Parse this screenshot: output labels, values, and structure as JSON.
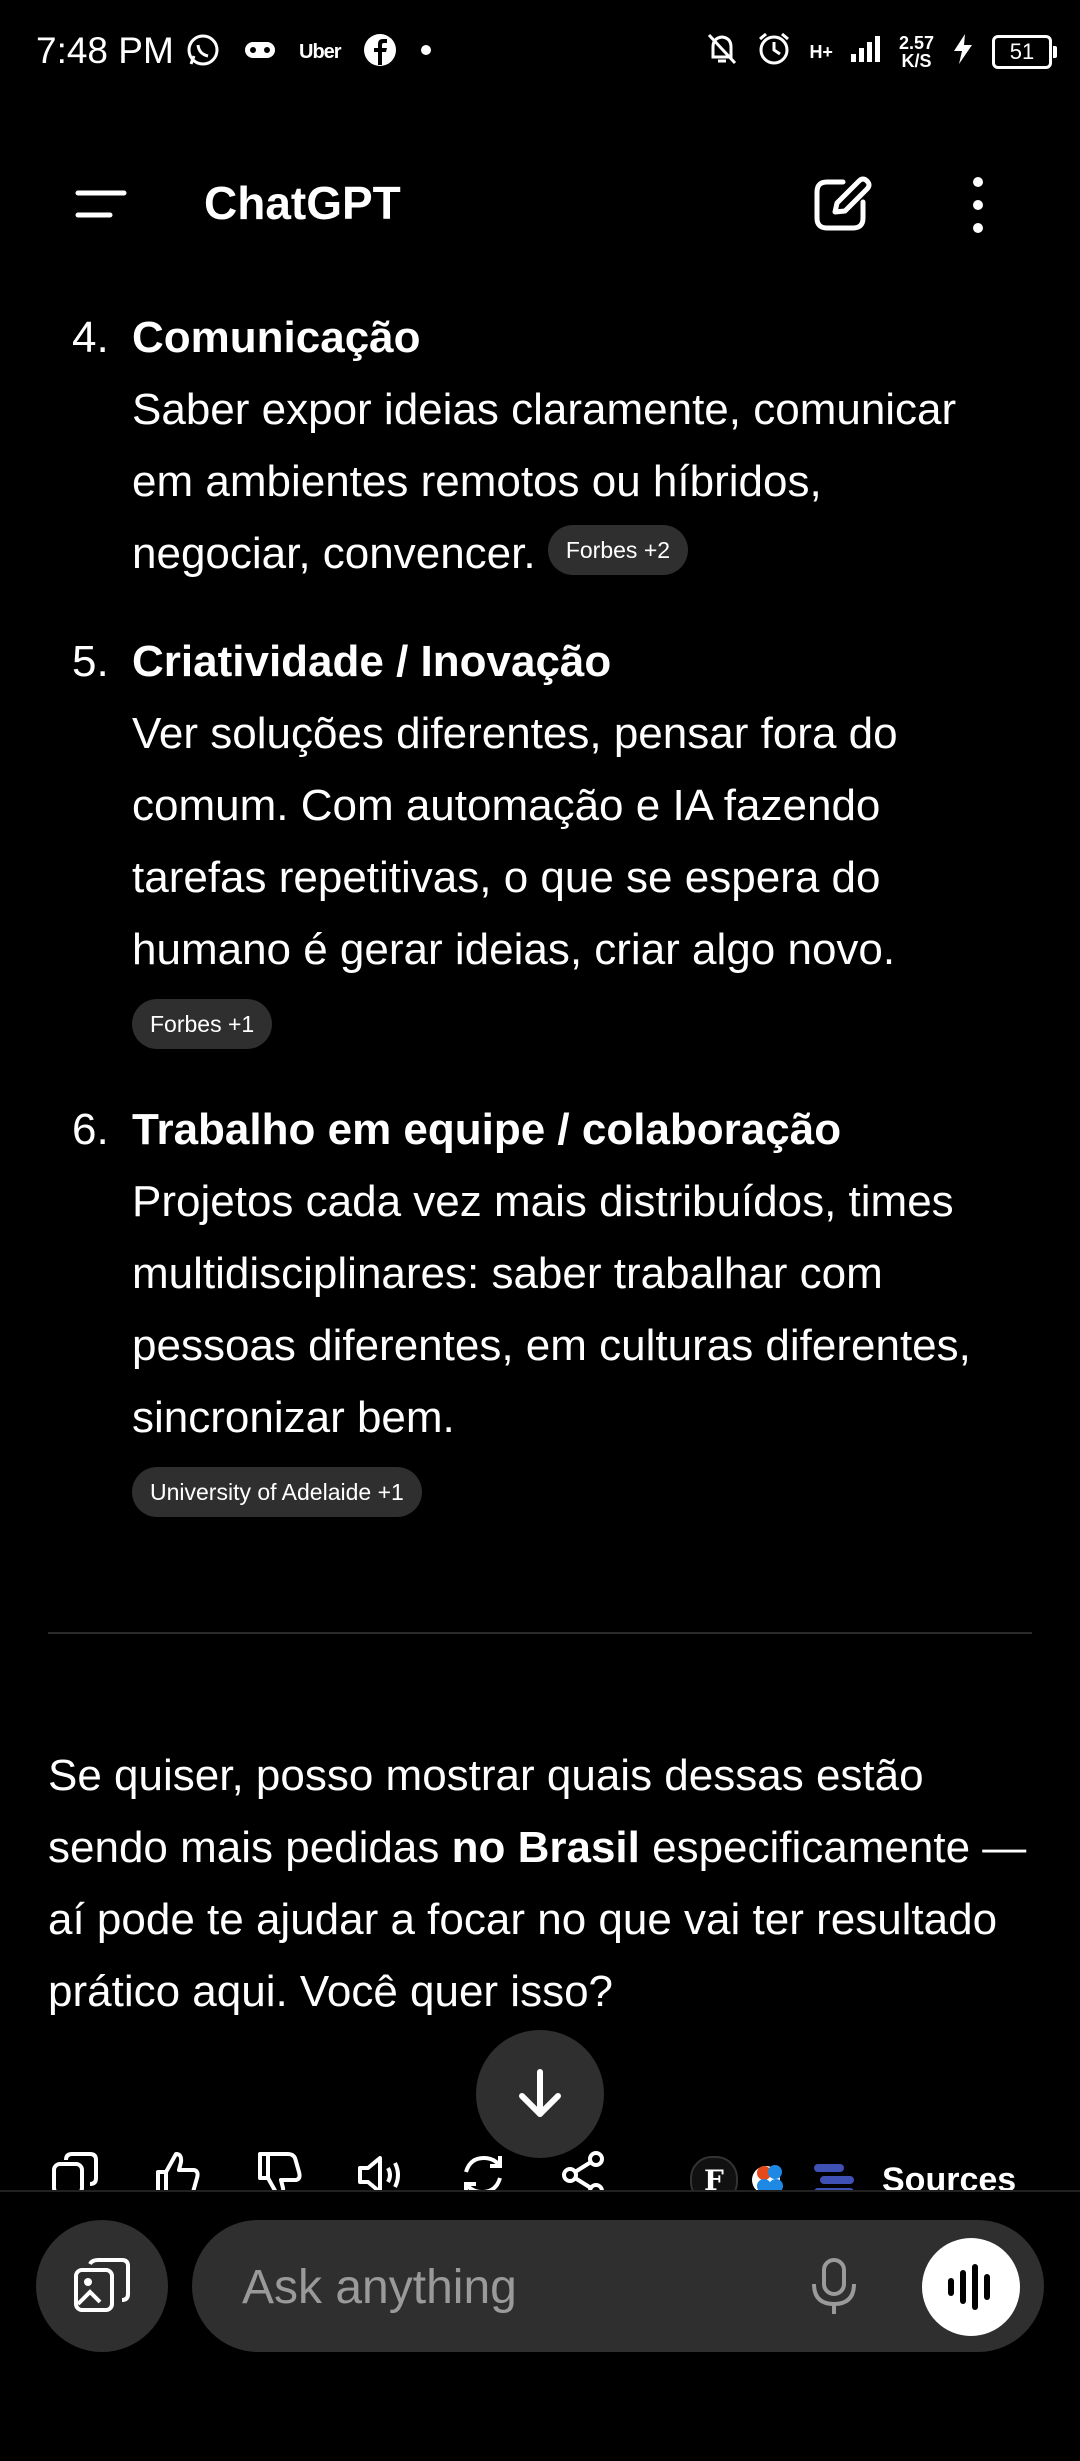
{
  "status_bar": {
    "time": "7:48 PM",
    "uber_label": "Uber",
    "net_type": "H+",
    "net_speed_value": "2.57",
    "net_speed_unit": "K/S",
    "battery": "51"
  },
  "app_bar": {
    "title": "ChatGPT"
  },
  "items": [
    {
      "number": "4.",
      "title": "Comunicação",
      "text": "Saber expor ideias claramente, comunicar em ambientes remotos ou híbridos, negociar, convencer.",
      "source_chip": "Forbes +2"
    },
    {
      "number": "5.",
      "title": "Criatividade / Inovação",
      "text": "Ver soluções diferentes, pensar fora do comum. Com automação e IA fazendo tarefas repetitivas, o que se espera do humano é gerar ideias, criar algo novo.",
      "source_chip": "Forbes +1"
    },
    {
      "number": "6.",
      "title": "Trabalho em equipe / colaboração",
      "text": "Projetos cada vez mais distribuídos, times multidisciplinares: saber trabalhar com pessoas diferentes, em culturas diferentes, sincronizar bem.",
      "source_chip": "University of Adelaide +1"
    }
  ],
  "follow_up": {
    "part1": "Se quiser, posso mostrar quais dessas estão sendo mais pedidas ",
    "bold": "no Brasil",
    "part2": " especificamente — aí pode te ajudar a focar no que vai ter resultado prático aqui. Você quer isso?"
  },
  "actions": {
    "sources_label": "Sources",
    "source_icon_letter": "F"
  },
  "composer": {
    "placeholder": "Ask anything"
  },
  "colors": {
    "background": "#000000",
    "chip": "#2f2f2f",
    "text": "#ffffff",
    "placeholder": "#9a9a9a"
  }
}
